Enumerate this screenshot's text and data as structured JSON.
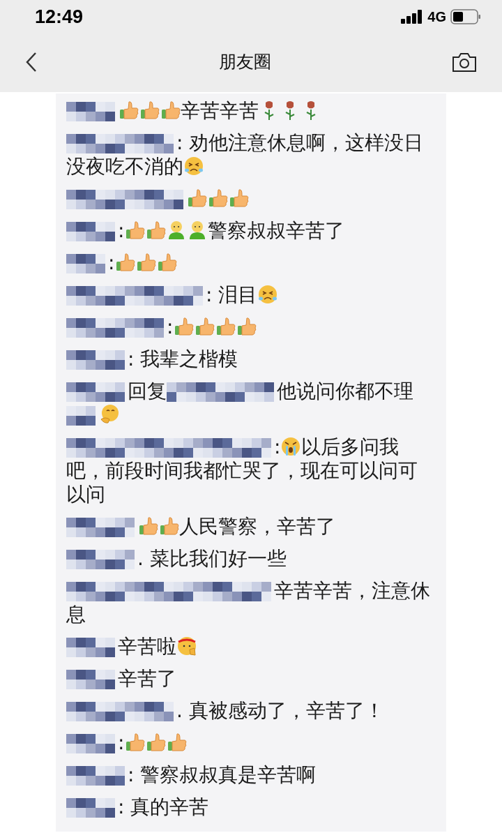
{
  "status_bar": {
    "time": "12:49",
    "network": "4G"
  },
  "nav": {
    "title": "朋友圈"
  },
  "comments": [
    {
      "segments": [
        {
          "kind": "name"
        },
        {
          "kind": "thumbs"
        },
        {
          "kind": "thumbs"
        },
        {
          "kind": "thumbs"
        },
        {
          "kind": "text",
          "text": "辛苦辛苦"
        },
        {
          "kind": "rose"
        },
        {
          "kind": "rose"
        },
        {
          "kind": "rose"
        }
      ]
    },
    {
      "segments": [
        {
          "kind": "name"
        },
        {
          "kind": "text",
          "text": ": 劝他注意休息啊，这样没日没夜吃不消的"
        },
        {
          "kind": "cry"
        }
      ]
    },
    {
      "segments": [
        {
          "kind": "name"
        },
        {
          "kind": "thumbs"
        },
        {
          "kind": "thumbs"
        },
        {
          "kind": "thumbs"
        }
      ]
    },
    {
      "segments": [
        {
          "kind": "name"
        },
        {
          "kind": "text",
          "text": ":"
        },
        {
          "kind": "thumbs"
        },
        {
          "kind": "thumbs"
        },
        {
          "kind": "figure"
        },
        {
          "kind": "figure"
        },
        {
          "kind": "text",
          "text": "警察叔叔辛苦了"
        }
      ]
    },
    {
      "segments": [
        {
          "kind": "name"
        },
        {
          "kind": "text",
          "text": ":"
        },
        {
          "kind": "thumbs"
        },
        {
          "kind": "thumbs"
        },
        {
          "kind": "thumbs"
        }
      ]
    },
    {
      "segments": [
        {
          "kind": "name"
        },
        {
          "kind": "text",
          "text": ": 泪目"
        },
        {
          "kind": "cry"
        }
      ]
    },
    {
      "segments": [
        {
          "kind": "name"
        },
        {
          "kind": "text",
          "text": ":"
        },
        {
          "kind": "thumbs"
        },
        {
          "kind": "thumbs"
        },
        {
          "kind": "thumbs"
        },
        {
          "kind": "thumbs"
        }
      ]
    },
    {
      "segments": [
        {
          "kind": "name"
        },
        {
          "kind": "text",
          "text": ": 我辈之楷模"
        }
      ]
    },
    {
      "segments": [
        {
          "kind": "name"
        },
        {
          "kind": "text",
          "text": "回复"
        },
        {
          "kind": "name"
        },
        {
          "kind": "text",
          "text": "他说问你都不理"
        },
        {
          "kind": "name"
        },
        {
          "kind": "smirk"
        }
      ]
    },
    {
      "segments": [
        {
          "kind": "name"
        },
        {
          "kind": "text",
          "text": ":"
        },
        {
          "kind": "wail"
        },
        {
          "kind": "text",
          "text": "以后多问我吧，前段时间我都忙哭了，现在可以问可以问"
        }
      ]
    },
    {
      "segments": [
        {
          "kind": "name"
        },
        {
          "kind": "thumbs"
        },
        {
          "kind": "thumbs"
        },
        {
          "kind": "text",
          "text": "人民警察，辛苦了"
        }
      ]
    },
    {
      "segments": [
        {
          "kind": "name"
        },
        {
          "kind": "text",
          "text": ". 菜比我们好一些"
        }
      ]
    },
    {
      "segments": [
        {
          "kind": "name"
        },
        {
          "kind": "text",
          "text": "辛苦辛苦，注意休息"
        }
      ]
    },
    {
      "segments": [
        {
          "kind": "name"
        },
        {
          "kind": "text",
          "text": "辛苦啦"
        },
        {
          "kind": "salute"
        }
      ]
    },
    {
      "segments": [
        {
          "kind": "name"
        },
        {
          "kind": "text",
          "text": "辛苦了"
        }
      ]
    },
    {
      "segments": [
        {
          "kind": "name"
        },
        {
          "kind": "text",
          "text": ". 真被感动了，辛苦了！"
        }
      ]
    },
    {
      "segments": [
        {
          "kind": "name"
        },
        {
          "kind": "text",
          "text": ":"
        },
        {
          "kind": "thumbs"
        },
        {
          "kind": "thumbs"
        },
        {
          "kind": "thumbs"
        }
      ]
    },
    {
      "segments": [
        {
          "kind": "name"
        },
        {
          "kind": "text",
          "text": ": 警察叔叔真是辛苦啊"
        }
      ]
    },
    {
      "segments": [
        {
          "kind": "name"
        },
        {
          "kind": "text",
          "text": ": 真的辛苦"
        }
      ]
    }
  ]
}
